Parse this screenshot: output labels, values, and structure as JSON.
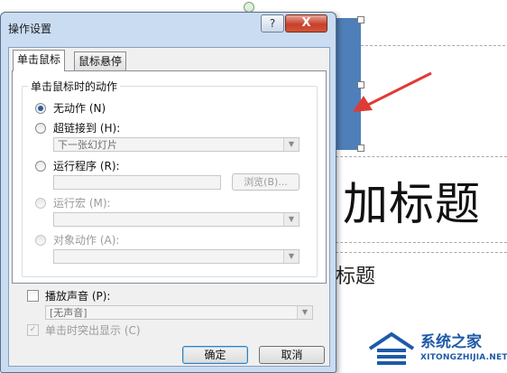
{
  "slide": {
    "title_text": "加标题",
    "subtitle_text": "标题"
  },
  "watermark": {
    "name": "系统之家",
    "url": "XITONGZHIJIA.NET"
  },
  "dialog": {
    "title": "操作设置",
    "help_label": "?",
    "close_label": "X",
    "tabs": [
      {
        "label": "单击鼠标",
        "active": true
      },
      {
        "label": "鼠标悬停",
        "active": false
      }
    ],
    "group_label": "单击鼠标时的动作",
    "options": {
      "none": {
        "label": "无动作 (N)",
        "checked": true
      },
      "hyperlink": {
        "label": "超链接到 (H):",
        "value": "下一张幻灯片"
      },
      "run_program": {
        "label": "运行程序 (R):",
        "value": "",
        "browse_label": "浏览(B)..."
      },
      "run_macro": {
        "label": "运行宏 (M):",
        "value": ""
      },
      "object_action": {
        "label": "对象动作 (A):",
        "value": ""
      }
    },
    "play_sound": {
      "label": "播放声音 (P):",
      "checked": false,
      "value": "[无声音]"
    },
    "highlight": {
      "label": "单击时突出显示 (C)",
      "checked": true
    },
    "ok_label": "确定",
    "cancel_label": "取消"
  },
  "colors": {
    "accent": "#4f7fb8",
    "arrow": "#e03a35"
  }
}
